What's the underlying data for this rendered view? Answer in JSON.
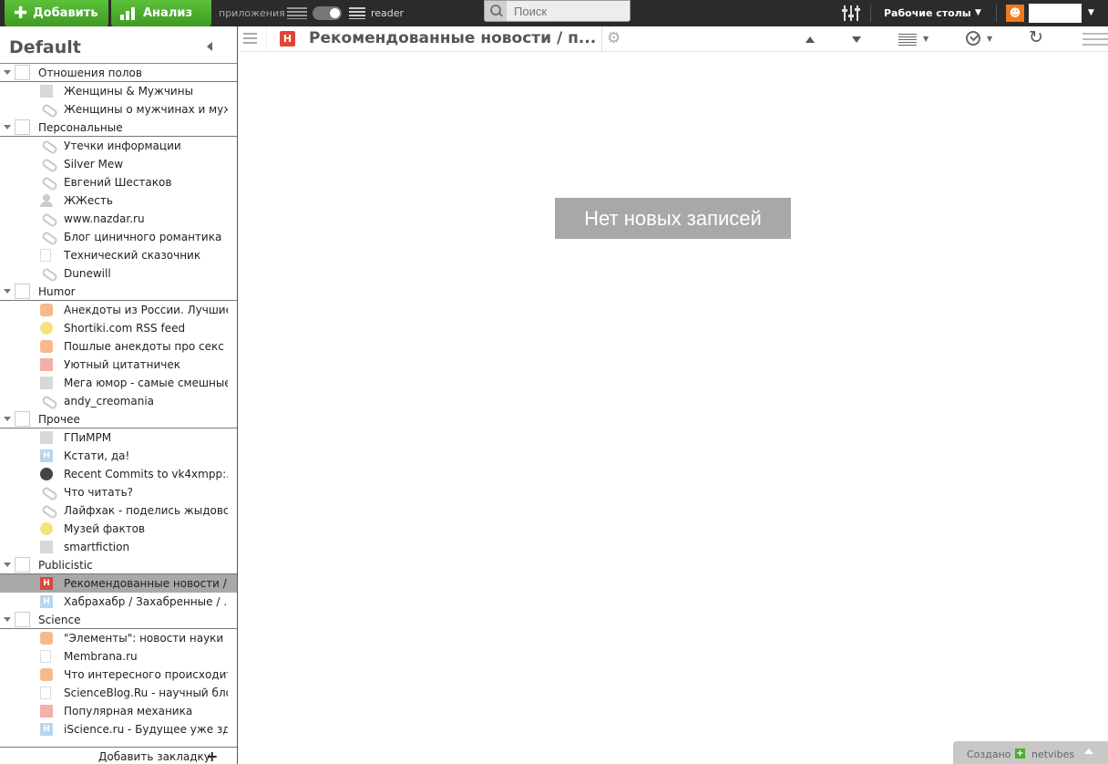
{
  "topbar": {
    "add_label": "Добавить",
    "analysis_label": "Анализ",
    "apps_label": "приложения",
    "reader_label": "reader",
    "search_placeholder": "Поиск",
    "desktops_label": "Рабочие столы"
  },
  "sidebar": {
    "title": "Default",
    "add_bookmark_label": "Добавить закладку",
    "categories": [
      {
        "label": "Отношения полов",
        "feeds": [
          {
            "label": "Женщины & Мужчины",
            "icon": "gray"
          },
          {
            "label": "Женщины о мужчинах и муж...",
            "icon": "clip"
          }
        ]
      },
      {
        "label": "Персональные",
        "feeds": [
          {
            "label": "Утечки информации",
            "icon": "clip"
          },
          {
            "label": "Silver Mew",
            "icon": "clip"
          },
          {
            "label": "Евгений Шестаков",
            "icon": "clip"
          },
          {
            "label": "ЖЖесть",
            "icon": "person"
          },
          {
            "label": "www.nazdar.ru",
            "icon": "clip"
          },
          {
            "label": "Блог циничного романтика",
            "icon": "clip"
          },
          {
            "label": "Технический сказочник",
            "icon": "page"
          },
          {
            "label": "Dunewill",
            "icon": "clip"
          }
        ]
      },
      {
        "label": "Humor",
        "feeds": [
          {
            "label": "Анекдоты из России. Лучшие...",
            "icon": "orange"
          },
          {
            "label": "Shortiki.com RSS feed",
            "icon": "yellow"
          },
          {
            "label": "Пошлые анекдоты про секс",
            "icon": "orange"
          },
          {
            "label": "Уютный цитатничек",
            "icon": "pink"
          },
          {
            "label": "Мега юмор - самые смешные...",
            "icon": "gray"
          },
          {
            "label": "andy_creomania",
            "icon": "clip"
          }
        ]
      },
      {
        "label": "Прочее",
        "feeds": [
          {
            "label": "ГПиМРМ",
            "icon": "gray"
          },
          {
            "label": "Кстати, да!",
            "icon": "blue"
          },
          {
            "label": "Recent Commits to vk4xmpp:...",
            "icon": "dark"
          },
          {
            "label": "Что читать?",
            "icon": "clip"
          },
          {
            "label": "Лайфхак - поделись жыдовс...",
            "icon": "clip"
          },
          {
            "label": "Музей фактов",
            "icon": "yellow"
          },
          {
            "label": "smartfiction",
            "icon": "gray"
          }
        ]
      },
      {
        "label": "Publicistic",
        "feeds": [
          {
            "label": "Рекомендованные новости / ...",
            "icon": "red",
            "selected": true
          },
          {
            "label": "Хабрахабр / Захабренные / ...",
            "icon": "blue"
          }
        ]
      },
      {
        "label": "Science",
        "feeds": [
          {
            "label": "\"Элементы\": новости науки",
            "icon": "orange"
          },
          {
            "label": "Membrana.ru",
            "icon": "page"
          },
          {
            "label": "Что интересного происходит ...",
            "icon": "orange"
          },
          {
            "label": "ScienceBlog.Ru - научный блог",
            "icon": "page"
          },
          {
            "label": "Популярная механика",
            "icon": "pink"
          },
          {
            "label": "iScience.ru - Будущее уже зд...",
            "icon": "blue"
          }
        ]
      }
    ]
  },
  "main": {
    "feed_icon_letter": "Н",
    "feed_title": "Рекомендованные новости / п...",
    "empty_message": "Нет новых записей"
  },
  "footer": {
    "created_label": "Создано",
    "brand": "netvibes"
  },
  "colors": {
    "accent_green": "#4caf2a",
    "topbar_bg": "#2b2b2b",
    "selected_bg": "#a8a8a8"
  }
}
